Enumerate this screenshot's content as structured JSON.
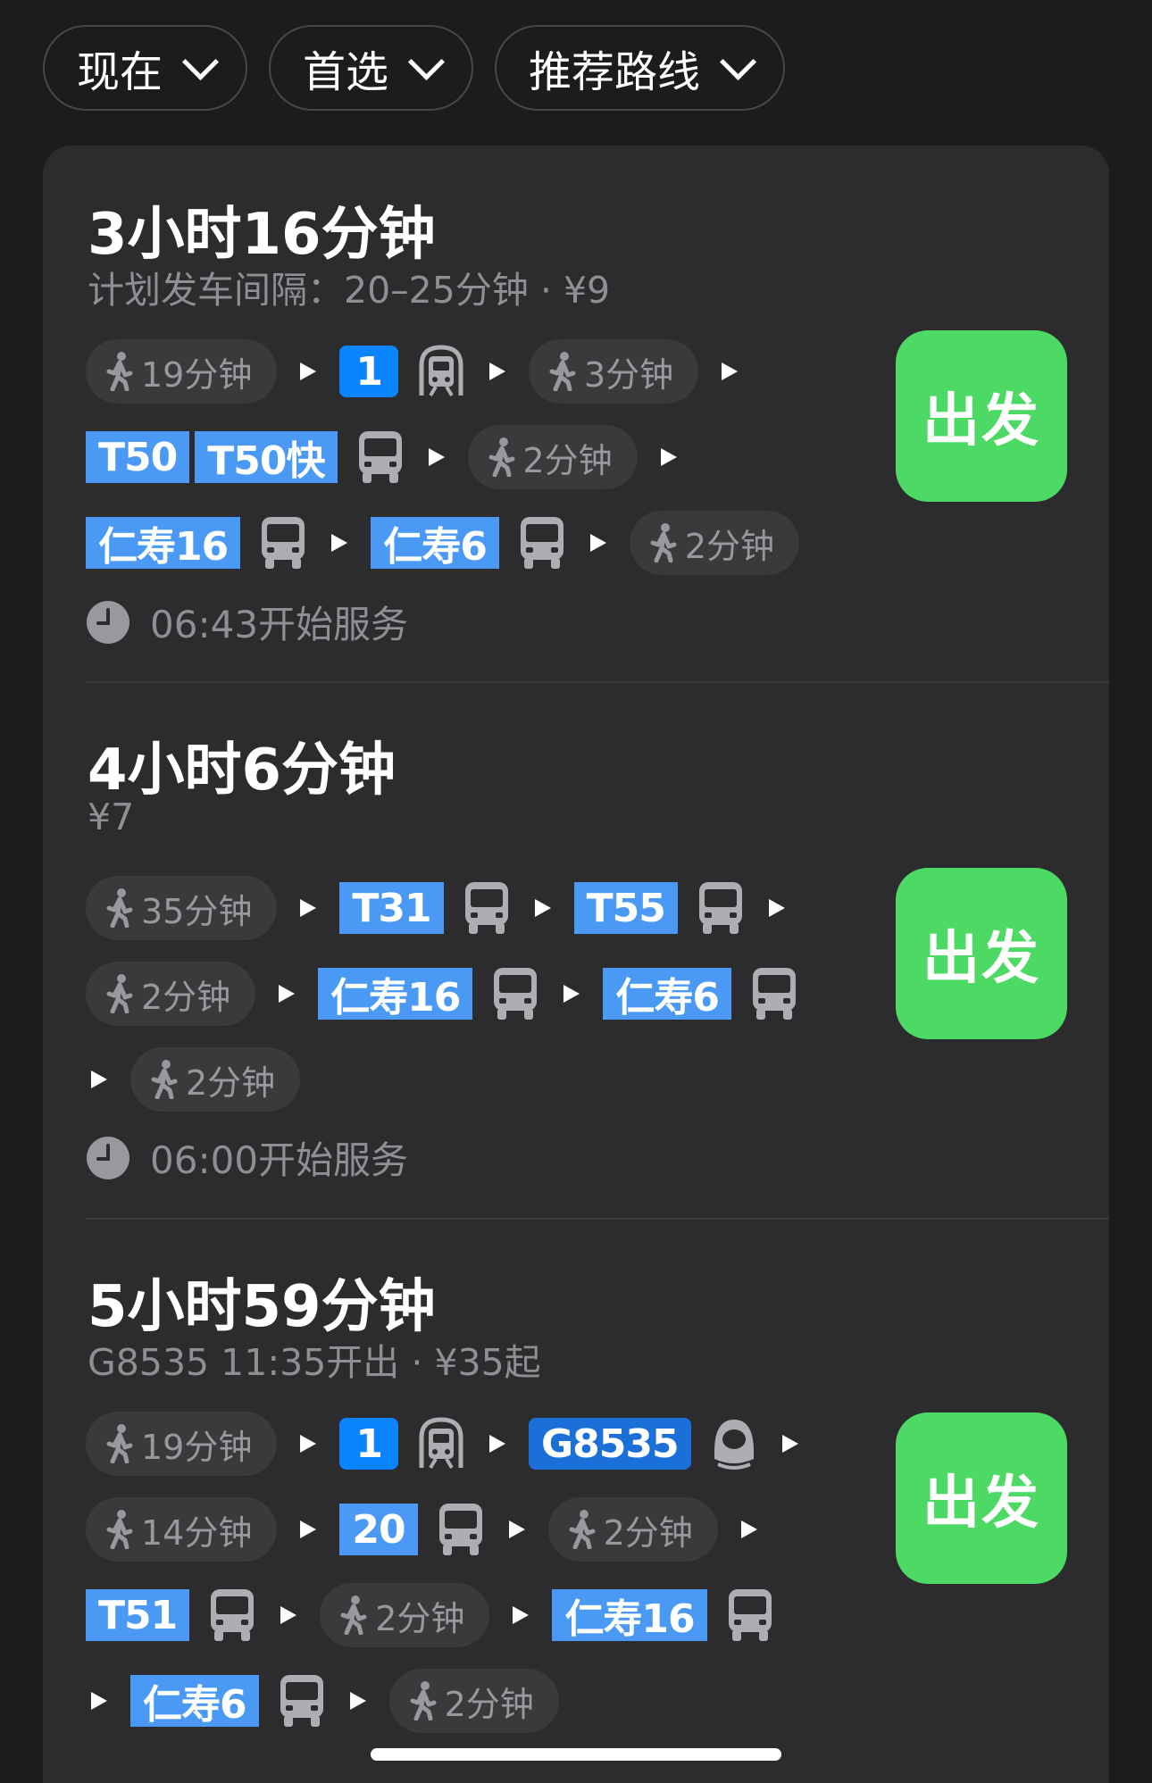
{
  "filters": [
    {
      "label": "现在"
    },
    {
      "label": "首选"
    },
    {
      "label": "推荐路线"
    }
  ],
  "go_label": "出发",
  "routes": [
    {
      "duration": "3小时16分钟",
      "subtitle": "计划发车间隔：20–25分钟 · ¥9",
      "service": "06:43开始服务",
      "walks": [
        "19分钟",
        "3分钟",
        "2分钟",
        "2分钟"
      ],
      "lines": [
        "1",
        "T50",
        "T50快",
        "仁寿16",
        "仁寿6"
      ]
    },
    {
      "duration": "4小时6分钟",
      "subtitle": "¥7",
      "service": "06:00开始服务",
      "walks": [
        "35分钟",
        "2分钟",
        "2分钟"
      ],
      "lines": [
        "T31",
        "T55",
        "仁寿16",
        "仁寿6"
      ]
    },
    {
      "duration": "5小时59分钟",
      "subtitle": "G8535 11:35开出 · ¥35起",
      "walks": [
        "19分钟",
        "14分钟",
        "2分钟",
        "2分钟",
        "2分钟"
      ],
      "lines": [
        "1",
        "G8535",
        "20",
        "T51",
        "仁寿16",
        "仁寿6"
      ]
    }
  ],
  "icons": {
    "walk": "walk-icon",
    "metro": "metro-icon",
    "bus": "bus-icon",
    "train": "high-speed-train-icon",
    "clock": "clock-icon",
    "chevron": "chevron-down-icon"
  },
  "colors": {
    "go_button": "#4cd964",
    "line_badge": "#4a9af5",
    "metro_badge": "#0a84ff",
    "train_badge": "#1b6fd8",
    "panel": "#2c2c2e",
    "background": "#1c1c1e"
  }
}
